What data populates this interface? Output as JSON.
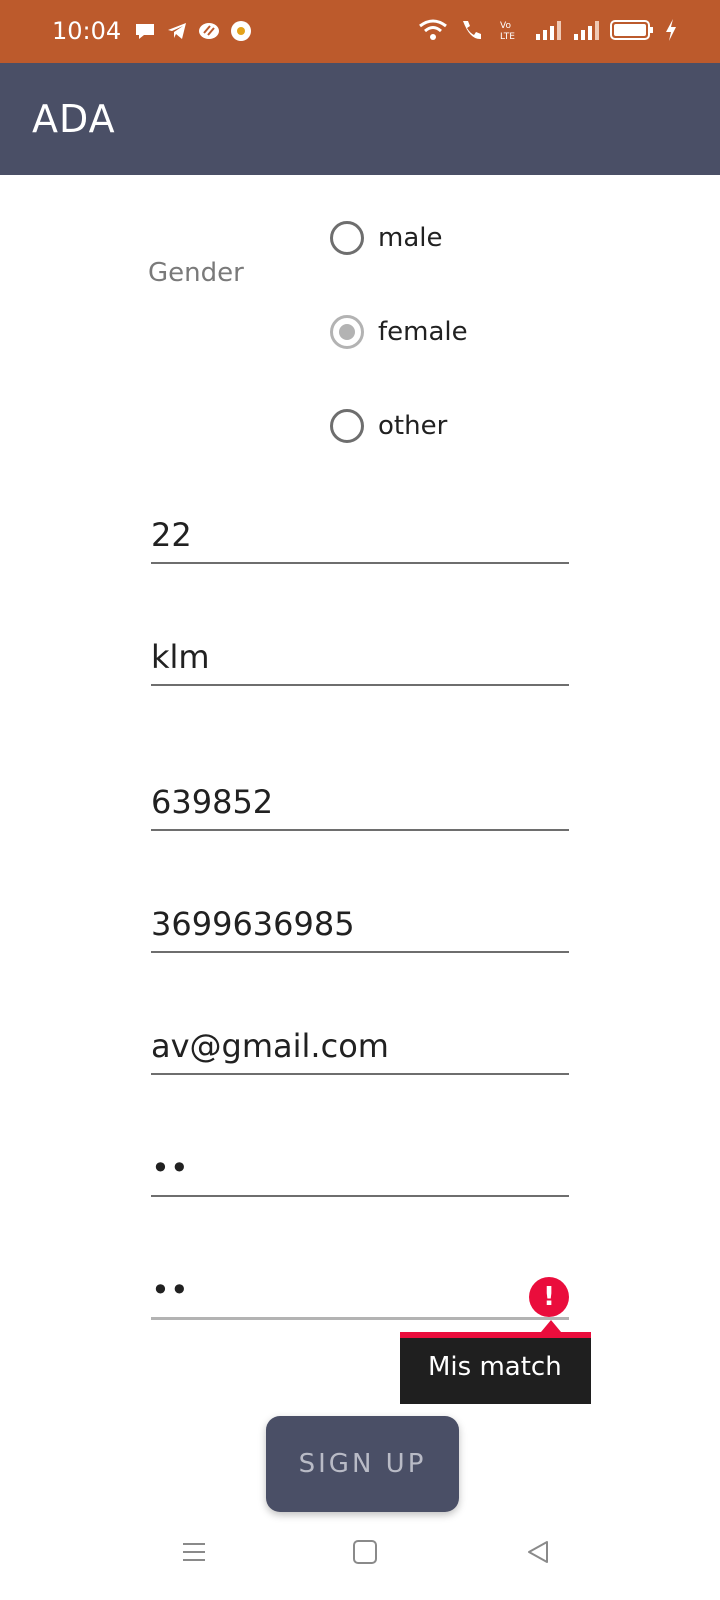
{
  "status_bar": {
    "time": "10:04",
    "left_icons": [
      "chat-icon",
      "telegram-icon",
      "app-icon",
      "notification-icon"
    ],
    "right_icons": [
      "wifi-icon",
      "call-icon",
      "volte-icon",
      "signal-icon",
      "signal-icon",
      "battery-icon",
      "charging-icon"
    ],
    "background": "#bc5a2c"
  },
  "app_bar": {
    "title": "ADA",
    "background": "#4a4f66"
  },
  "form": {
    "gender_label": "Gender",
    "gender_options": [
      {
        "label": "male",
        "checked": false
      },
      {
        "label": "female",
        "checked": true
      },
      {
        "label": "other",
        "checked": false
      }
    ],
    "fields": [
      {
        "value": "22"
      },
      {
        "value": "klm"
      },
      {
        "value": "639852"
      },
      {
        "value": "3699636985"
      },
      {
        "value": "av@gmail.com"
      },
      {
        "value": "••"
      },
      {
        "value": "••",
        "error": true
      }
    ],
    "error_tooltip": "Mis match",
    "error_color": "#ea0d3c"
  },
  "signup_button": {
    "label": "SIGN UP"
  },
  "nav_bar": {
    "buttons": [
      "menu-icon",
      "home-icon",
      "back-icon"
    ]
  }
}
